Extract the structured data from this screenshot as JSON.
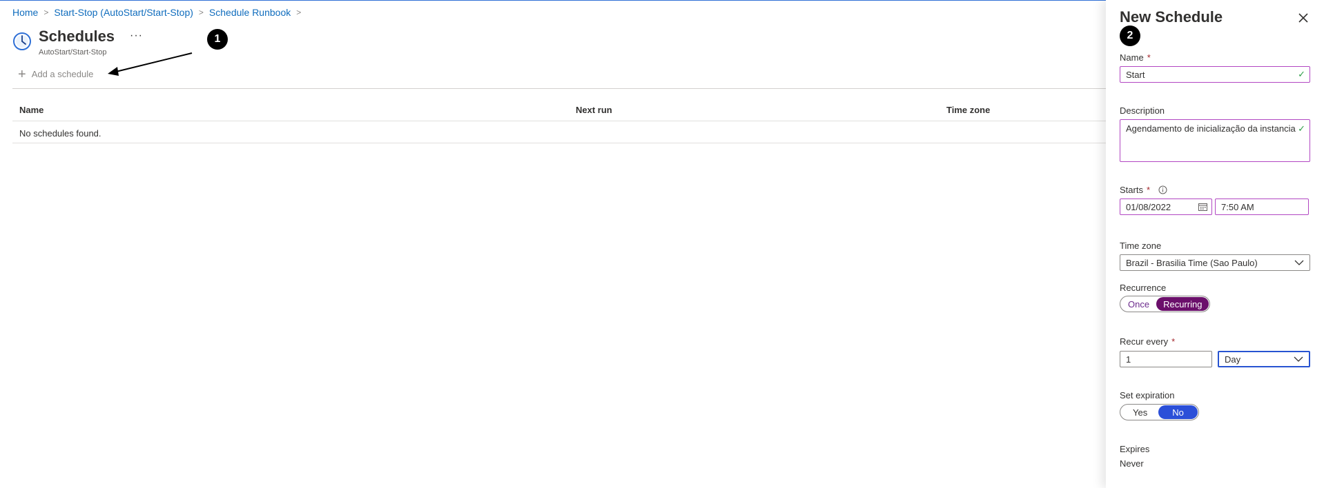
{
  "breadcrumb": {
    "items": [
      "Home",
      "Start-Stop (AutoStart/Start-Stop)",
      "Schedule Runbook"
    ]
  },
  "header": {
    "title": "Schedules",
    "subtitle": "AutoStart/Start-Stop",
    "more_label": "···",
    "icon": "clock-icon"
  },
  "annotations": {
    "step1": "1",
    "step2": "2"
  },
  "toolbar": {
    "add_label": "Add a schedule",
    "add_icon": "plus-icon"
  },
  "table": {
    "columns": [
      "Name",
      "Next run",
      "Time zone"
    ],
    "empty_message": "No schedules found."
  },
  "panel": {
    "title": "New Schedule",
    "name": {
      "label": "Name",
      "required_mark": "*",
      "value": "Start"
    },
    "description": {
      "label": "Description",
      "value": "Agendamento de inicialização da instancia"
    },
    "starts": {
      "label": "Starts",
      "required_mark": "*",
      "date": "01/08/2022",
      "time": "7:50 AM"
    },
    "time_zone": {
      "label": "Time zone",
      "value": "Brazil - Brasilia Time (Sao Paulo)"
    },
    "recurrence": {
      "label": "Recurrence",
      "options": [
        "Once",
        "Recurring"
      ],
      "selected": "Recurring"
    },
    "recur_every": {
      "label": "Recur every",
      "required_mark": "*",
      "value": "1",
      "unit": "Day"
    },
    "set_expiration": {
      "label": "Set expiration",
      "options": [
        "Yes",
        "No"
      ],
      "selected": "No"
    },
    "expires": {
      "label": "Expires",
      "value": "Never"
    }
  },
  "colors": {
    "link": "#0f6cbd",
    "field_border": "#b146c2",
    "recurring_selected": "#6b0f6b",
    "no_selected": "#2b4fd8",
    "valid_check": "#2e9e47"
  }
}
